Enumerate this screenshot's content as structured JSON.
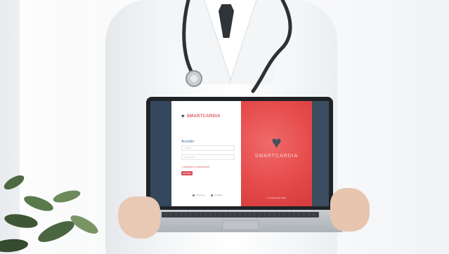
{
  "login": {
    "brand": "SMARTCARDIA",
    "title": "Acceder",
    "username_placeholder": "usuario",
    "password_placeholder": "contraseña",
    "forgot_link": "¿Olvidaste tu contraseña?",
    "submit_label": "ENTRAR",
    "footer": [
      {
        "label": "Términos"
      },
      {
        "label": "Contacto"
      }
    ]
  },
  "brand_panel": {
    "logo_text": "SMARTCARDIA",
    "copyright": "© Smartcardia 2020"
  },
  "icons": {
    "small_heart": "heart-icon",
    "big_heart": "heart-icon"
  },
  "colors": {
    "brand_red": "#e64b4b",
    "button_red": "#d9485a",
    "heart_dark": "#43505d"
  }
}
